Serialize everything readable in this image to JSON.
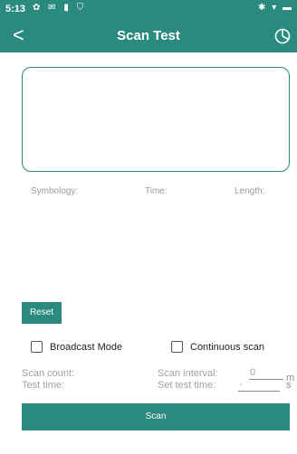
{
  "status_bar": {
    "time": "5:13",
    "notification_icons": "✿ ✉ ▮ ⛉",
    "system_icons": "✱ ▾ ▬"
  },
  "app_bar": {
    "back_icon": "<",
    "title": "Scan Test",
    "history_icon": "clock-icon"
  },
  "result_box": {
    "text": ""
  },
  "info": {
    "symbology_label": "Symbology:",
    "time_label": "Time:",
    "length_label": "Length:"
  },
  "reset_label": "Reset",
  "options": {
    "broadcast_mode": "Broadcast Mode",
    "continuous_scan": "Continuous scan"
  },
  "fields": {
    "scan_count_label": "Scan count:",
    "scan_interval_label": "Scan interval:",
    "scan_interval_value": "0",
    "scan_interval_unit": "m",
    "test_time_label": "Test time:",
    "set_test_time_label": "Set test time:",
    "set_test_time_value": "-",
    "set_test_time_unit": "s"
  },
  "scan_label": "Scan",
  "colors": {
    "accent": "#2a8a7e"
  }
}
